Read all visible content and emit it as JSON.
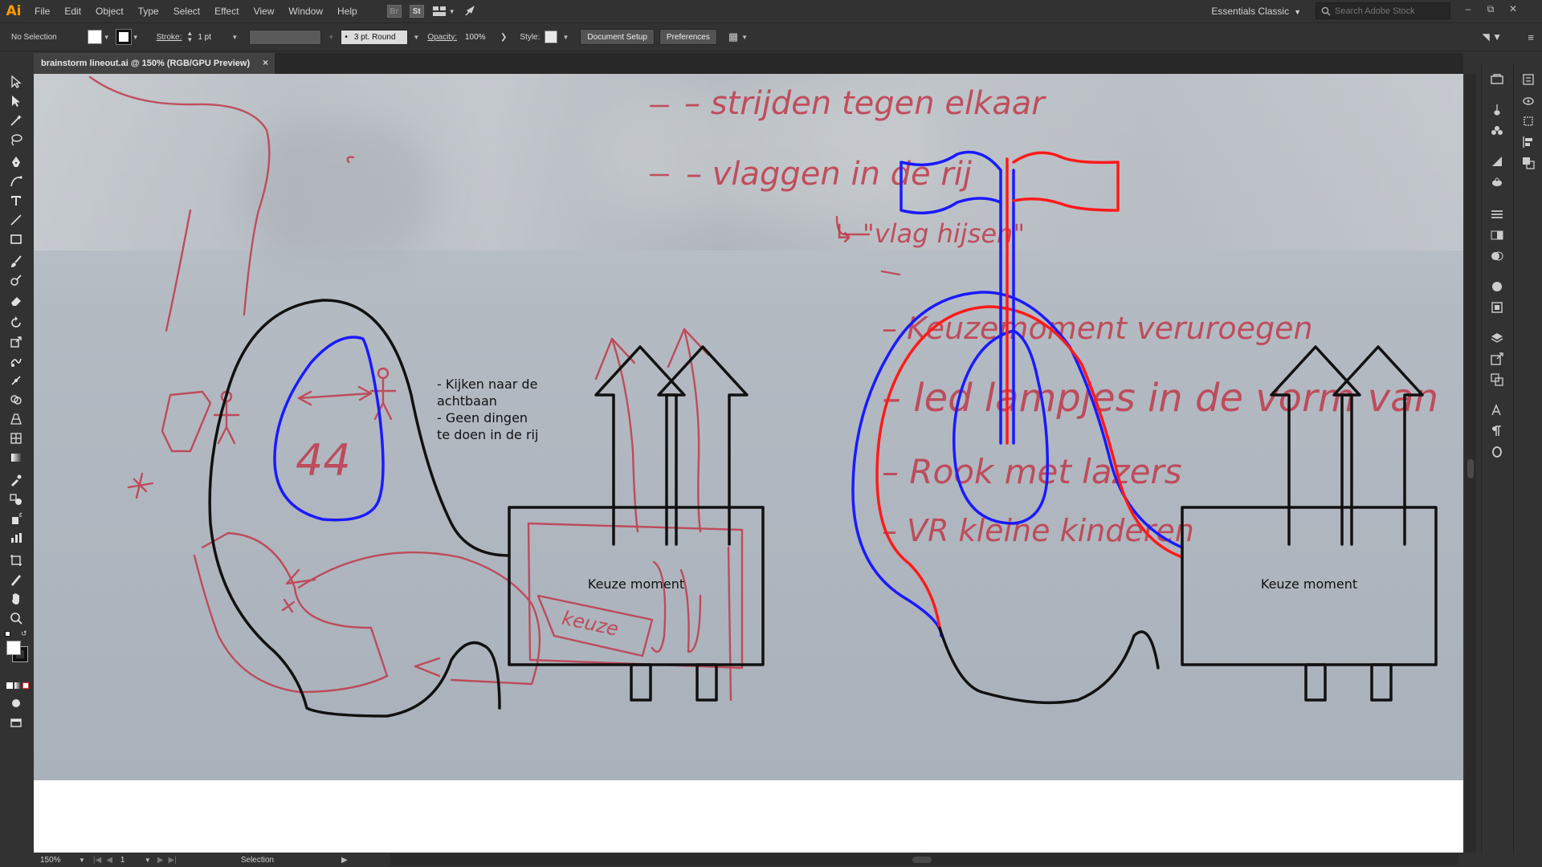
{
  "app": {
    "logo": "Ai",
    "accent": "#ff9a00"
  },
  "menu": [
    "File",
    "Edit",
    "Object",
    "Type",
    "Select",
    "Effect",
    "View",
    "Window",
    "Help"
  ],
  "menu_icons": {
    "bridge": "Br",
    "stock": "St",
    "arrange": "arrange-documents-icon",
    "gpu": "rocket-icon"
  },
  "workspace": "Essentials Classic",
  "search": {
    "placeholder": "Search Adobe Stock"
  },
  "controlbar": {
    "selection": "No Selection",
    "stroke_label": "Stroke:",
    "stroke_value": "1 pt",
    "brush": "3 pt. Round",
    "opacity_label": "Opacity:",
    "opacity_value": "100%",
    "style_label": "Style:",
    "document_setup": "Document Setup",
    "preferences": "Preferences"
  },
  "document": {
    "tab_title": "brainstorm lineout.ai @ 150% (RGB/GPU Preview)",
    "close": "×"
  },
  "artboard": {
    "notes": "- Kijken naar de\nachtbaan\n- Geen dingen\nte doen in de rij",
    "box_left_label": "Keuze moment",
    "box_right_label": "Keuze moment",
    "handwriting": {
      "line1": "– strijden tegen elkaar",
      "line2": "– vlaggen in de rij",
      "line3": "↳ \"vlag hijsen\"",
      "line4": "– Keuzemoment veruroegen",
      "line5": "– led lampjes in de vorm van",
      "line6": "– Rook met lazers",
      "line7": "– VR kleine kinderen",
      "number": "44",
      "keuze": "keuze"
    }
  },
  "colors": {
    "ink_red": "#c0394a",
    "vector_blue": "#1a1aff",
    "vector_red": "#ff1a1a",
    "vector_black": "#111111"
  },
  "status": {
    "zoom": "150%",
    "page": "1",
    "tool": "Selection"
  }
}
